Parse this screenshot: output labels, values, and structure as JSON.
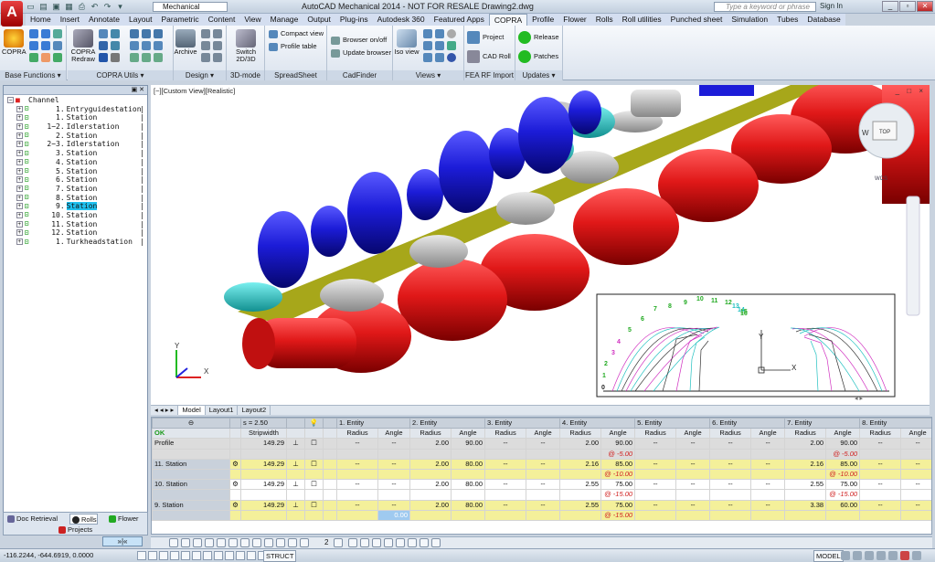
{
  "app": {
    "icon_letter": "A",
    "workspace": "Mechanical",
    "title": "AutoCAD Mechanical 2014 - NOT FOR RESALE   Drawing2.dwg",
    "search_placeholder": "Type a keyword or phrase",
    "sign_in": "Sign In"
  },
  "tabs": [
    "Home",
    "Insert",
    "Annotate",
    "Layout",
    "Parametric",
    "Content",
    "View",
    "Manage",
    "Output",
    "Plug-ins",
    "Autodesk 360",
    "Featured Apps",
    "COPRA",
    "Profile",
    "Flower",
    "Rolls",
    "Roll utilities",
    "Punched sheet",
    "Simulation",
    "Tubes",
    "Database"
  ],
  "active_tab": "COPRA",
  "ribbon": {
    "panels": [
      "Base Functions ▾",
      "COPRA Utils ▾",
      "Design ▾",
      "3D-mode",
      "SpreadSheet",
      "CadFinder",
      "Views ▾",
      "FEA RF Import",
      "Updates ▾"
    ],
    "copra": "COPRA",
    "copra_redraw": "COPRA Redraw",
    "archive": "Archive",
    "switch_2d3d": "Switch 2D/3D",
    "compact_view": "Compact view",
    "profile_table": "Profile table",
    "browser_onoff": "Browser on/off",
    "update_browser": "Update browser",
    "iso_view": "Iso view",
    "project": "Project",
    "cad_roll": "CAD Roll",
    "release": "Release",
    "patches": "Patches"
  },
  "tree": [
    {
      "num": "",
      "label": "Channel",
      "exp": "−"
    },
    {
      "num": "1.",
      "label": "Entryguidestation",
      "exp": "+"
    },
    {
      "num": "1.",
      "label": "Station",
      "exp": "+"
    },
    {
      "num": "1−2.",
      "label": "Idlerstation",
      "exp": "+"
    },
    {
      "num": "2.",
      "label": "Station",
      "exp": "+"
    },
    {
      "num": "2−3.",
      "label": "Idlerstation",
      "exp": "+"
    },
    {
      "num": "3.",
      "label": "Station",
      "exp": "+"
    },
    {
      "num": "4.",
      "label": "Station",
      "exp": "+"
    },
    {
      "num": "5.",
      "label": "Station",
      "exp": "+"
    },
    {
      "num": "6.",
      "label": "Station",
      "exp": "+"
    },
    {
      "num": "7.",
      "label": "Station",
      "exp": "+"
    },
    {
      "num": "8.",
      "label": "Station",
      "exp": "+"
    },
    {
      "num": "9.",
      "label": "Station",
      "exp": "+"
    },
    {
      "num": "10.",
      "label": "Station",
      "exp": "+"
    },
    {
      "num": "11.",
      "label": "Station",
      "exp": "+"
    },
    {
      "num": "12.",
      "label": "Station",
      "exp": "+"
    },
    {
      "num": "1.",
      "label": "Turkheadstation",
      "exp": "+"
    }
  ],
  "selected_tree_index": 12,
  "sidebar_tabs": {
    "doc": "Doc Retrieval",
    "rolls": "Rolls",
    "flower": "Flower",
    "projects": "Projects"
  },
  "nav_button": "»|«",
  "viewport": {
    "label": "[−][Custom View][Realistic]",
    "controls": "_ □ ×",
    "viewcube": {
      "w": "W",
      "top": "TOP"
    },
    "wcs": "WCS",
    "axis_x": "X",
    "axis_y": "Y",
    "flower_labels": [
      "0",
      "1",
      "2",
      "3",
      "4",
      "5",
      "6",
      "7",
      "8",
      "9",
      "10",
      "11",
      "12",
      "13",
      "14",
      "15",
      "16"
    ]
  },
  "layouts": [
    "Model",
    "Layout1",
    "Layout2"
  ],
  "grid": {
    "header": {
      "s": "s = 2.50",
      "stripwidth": "Stripwidth",
      "ok": "OK",
      "entities": [
        "1. Entity",
        "2. Entity",
        "3. Entity",
        "4. Entity",
        "5. Entity",
        "6. Entity",
        "7. Entity",
        "8. Entity"
      ],
      "radius": "Radius",
      "angle": "Angle"
    },
    "rows": [
      {
        "name": "Profile",
        "sw": "149.29",
        "cells": [
          "--",
          "--",
          "2.00",
          "90.00",
          "--",
          "--",
          "2.00",
          "90.00",
          "--",
          "--",
          "--",
          "--",
          "2.00",
          "90.00",
          "--",
          "--"
        ],
        "sub": [
          "",
          "",
          "",
          "",
          "",
          "",
          "",
          "@ -5.00",
          "",
          "",
          "",
          "",
          "",
          "@ -5.00",
          "",
          ""
        ],
        "type": "profile"
      },
      {
        "name": "11. Station",
        "sw": "149.29",
        "cells": [
          "--",
          "--",
          "2.00",
          "80.00",
          "--",
          "--",
          "2.16",
          "85.00",
          "--",
          "--",
          "--",
          "--",
          "2.16",
          "85.00",
          "--",
          "--"
        ],
        "sub": [
          "",
          "",
          "",
          "",
          "",
          "",
          "",
          "@ -10.00",
          "",
          "",
          "",
          "",
          "",
          "@ -10.00",
          "",
          ""
        ],
        "type": "yel"
      },
      {
        "name": "10. Station",
        "sw": "149.29",
        "cells": [
          "--",
          "--",
          "2.00",
          "80.00",
          "--",
          "--",
          "2.55",
          "75.00",
          "--",
          "--",
          "--",
          "--",
          "2.55",
          "75.00",
          "--",
          "--"
        ],
        "sub": [
          "",
          "",
          "",
          "",
          "",
          "",
          "",
          "@ -15.00",
          "",
          "",
          "",
          "",
          "",
          "@ -15.00",
          "",
          ""
        ],
        "type": "white"
      },
      {
        "name": "9. Station",
        "sw": "149.29",
        "cells": [
          "--",
          "--",
          "2.00",
          "80.00",
          "--",
          "--",
          "2.55",
          "75.00",
          "--",
          "--",
          "--",
          "--",
          "3.38",
          "60.00",
          "--",
          "--"
        ],
        "sub": [
          "",
          "0.00",
          "",
          "",
          "",
          "",
          "",
          "@ -15.00",
          "",
          "",
          "",
          "",
          "",
          "",
          "",
          ""
        ],
        "type": "yel"
      }
    ]
  },
  "status": {
    "coords": "-116.2244, -644.6919, 0.0000",
    "struct": "STRUCT",
    "model": "MODEL",
    "scale": "2"
  },
  "colors": {
    "roll_red": "#e01818",
    "roll_blue": "#1c1cd8",
    "roll_grey": "#b8b8b8",
    "roll_cyan": "#21c6c6",
    "strip": "#a7a71a",
    "selection": "#1fc1f0",
    "row_yellow": "#f4f09a"
  }
}
